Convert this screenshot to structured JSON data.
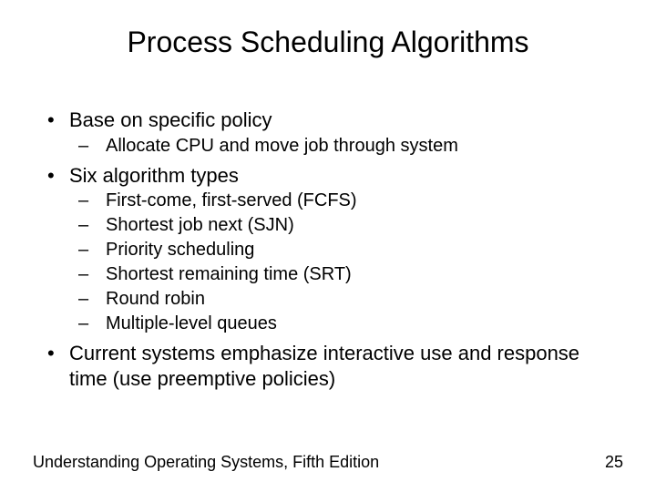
{
  "title": "Process Scheduling Algorithms",
  "bullets": {
    "b1": "Base on specific policy",
    "b1_1": "Allocate CPU and move job through system",
    "b2": "Six algorithm types",
    "b2_1": "First-come, first-served (FCFS)",
    "b2_2": "Shortest job next (SJN)",
    "b2_3": "Priority scheduling",
    "b2_4": "Shortest remaining time (SRT)",
    "b2_5": "Round robin",
    "b2_6": "Multiple-level queues",
    "b3": "Current systems emphasize interactive use and response time (use preemptive policies)"
  },
  "footer": {
    "source": "Understanding Operating Systems, Fifth Edition",
    "page": "25"
  }
}
